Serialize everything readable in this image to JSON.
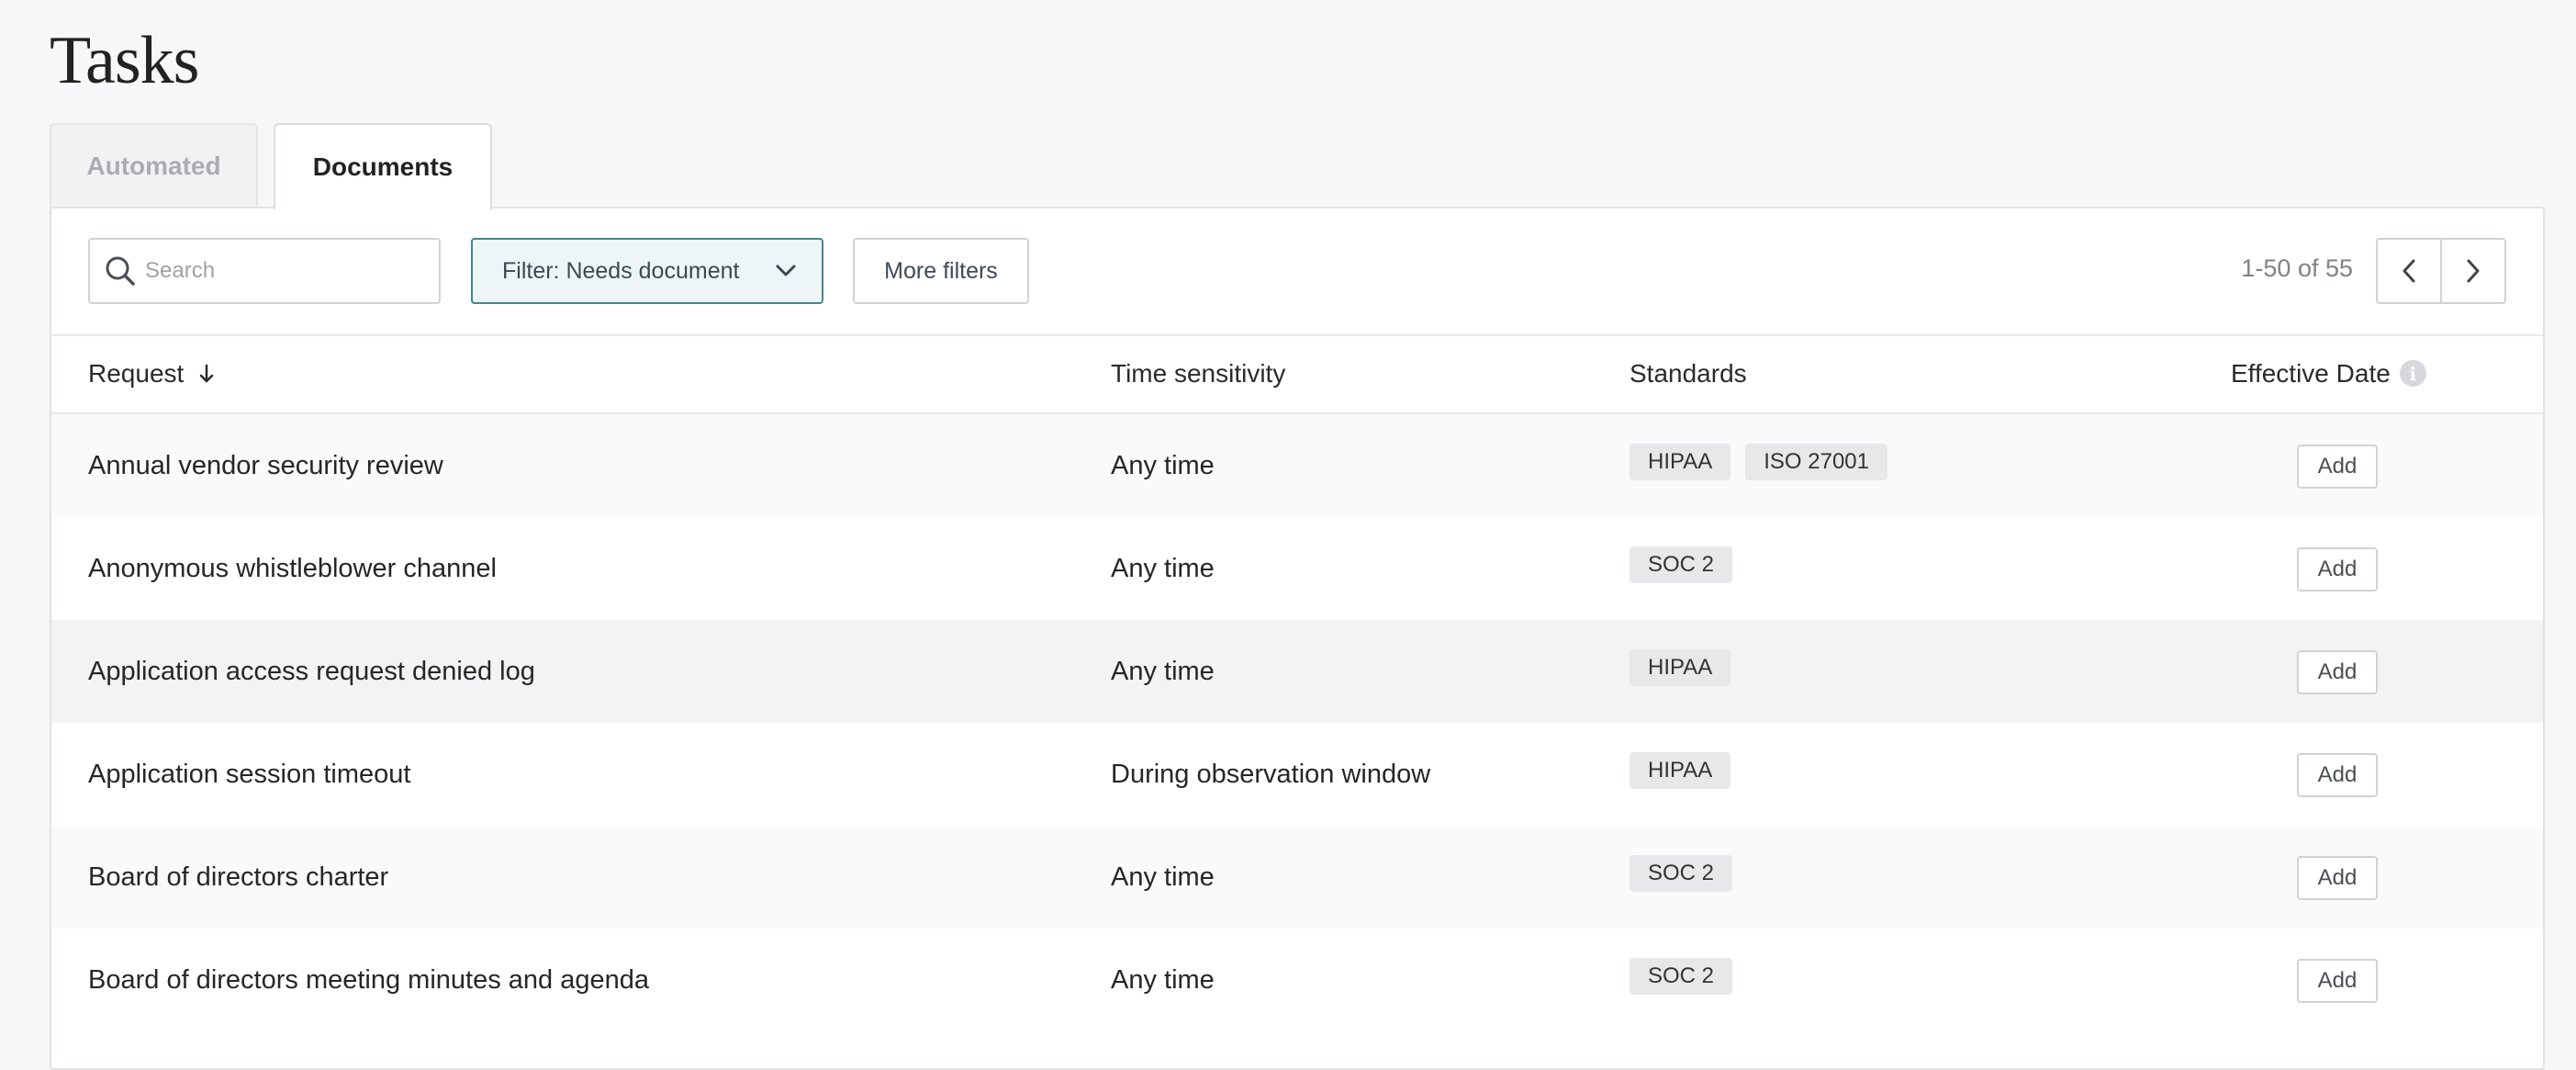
{
  "page": {
    "title": "Tasks"
  },
  "tabs": [
    {
      "label": "Automated",
      "active": false
    },
    {
      "label": "Documents",
      "active": true
    }
  ],
  "toolbar": {
    "search_placeholder": "Search",
    "search_value": "",
    "filter_label": "Filter: Needs document",
    "more_filters_label": "More filters",
    "pagination_text": "1-50 of 55",
    "icons": {
      "search": "search-icon",
      "filter_chevron": "chevron-down-icon",
      "prev": "chevron-left-icon",
      "next": "chevron-right-icon"
    }
  },
  "table": {
    "columns": {
      "request": "Request",
      "time_sensitivity": "Time sensitivity",
      "standards": "Standards",
      "effective_date": "Effective Date"
    },
    "sort": {
      "column": "request",
      "direction": "descending-arrow"
    },
    "add_label": "Add",
    "rows": [
      {
        "request": "Annual vendor security review",
        "time": "Any time",
        "standards": [
          "HIPAA",
          "ISO 27001"
        ]
      },
      {
        "request": "Anonymous whistleblower channel",
        "time": "Any time",
        "standards": [
          "SOC 2"
        ]
      },
      {
        "request": "Application access request denied log",
        "time": "Any time",
        "standards": [
          "HIPAA"
        ]
      },
      {
        "request": "Application session timeout",
        "time": "During observation window",
        "standards": [
          "HIPAA"
        ]
      },
      {
        "request": "Board of directors charter",
        "time": "Any time",
        "standards": [
          "SOC 2"
        ]
      },
      {
        "request": "Board of directors meeting minutes and agenda",
        "time": "Any time",
        "standards": [
          "SOC 2"
        ]
      }
    ]
  },
  "colors": {
    "filter_border": "#3e8a8c",
    "filter_background": "#eef5f6",
    "badge_background": "#e7e8ea"
  }
}
